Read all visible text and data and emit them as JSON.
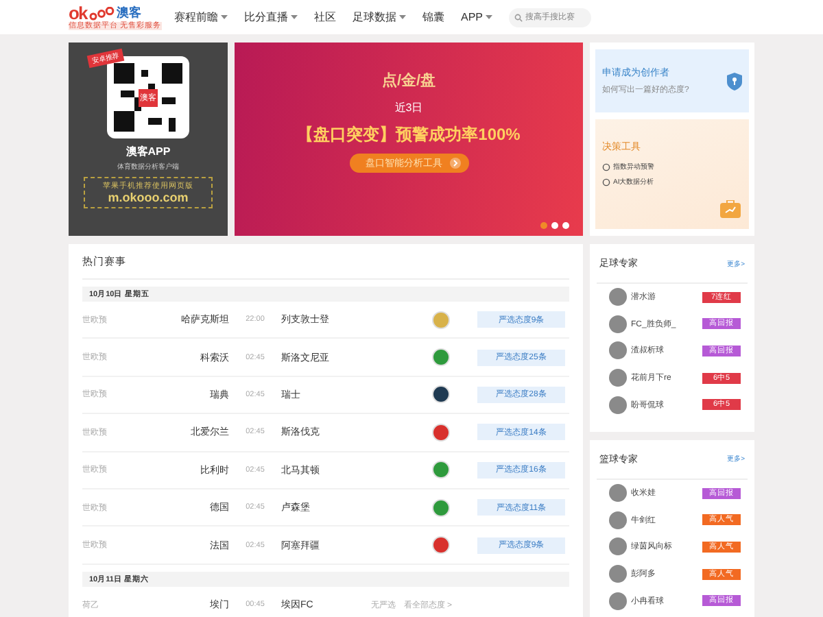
{
  "header": {
    "logo": {
      "mark": "ok",
      "name": "澳客",
      "slogan": "信息数据平台 无售彩服务"
    },
    "nav": [
      {
        "label": "赛程前瞻",
        "has_menu": true
      },
      {
        "label": "比分直播",
        "has_menu": true
      },
      {
        "label": "社区",
        "has_menu": false
      },
      {
        "label": "足球数据",
        "has_menu": true
      },
      {
        "label": "锦囊",
        "has_menu": false
      },
      {
        "label": "APP",
        "has_menu": true
      }
    ],
    "search": {
      "placeholder": "搜高手搜比赛"
    }
  },
  "app_promo": {
    "ribbon": "安卓推荐",
    "qr_badge": "澳客",
    "title": "澳客APP",
    "subtitle": "体育数据分析客户端",
    "note": "苹果手机推荐使用网页版",
    "url": "m.okooo.com"
  },
  "banner": {
    "heading": "点/金/盘",
    "line": "近3日",
    "headline": "【盘口突变】预警成功率100%",
    "button": "盘口智能分析工具",
    "dots": [
      {
        "selected": true
      },
      {
        "selected": false
      },
      {
        "selected": false
      }
    ]
  },
  "creator_card": {
    "title": "申请成为创作者",
    "subtitle": "如何写出一篇好的态度?"
  },
  "tools_card": {
    "title": "决策工具",
    "items": [
      "指数异动预警",
      "AI大数据分析"
    ]
  },
  "hot_matches": {
    "title": "热门赛事",
    "days": [
      {
        "date": "10月10日 星期五",
        "matches": [
          {
            "league": "世欧预",
            "home": "哈萨克斯坦",
            "time": "22:00",
            "away": "列支敦士登",
            "color": "#d8b24a",
            "kind": "pick",
            "action": "严选态度9条"
          },
          {
            "league": "世欧预",
            "home": "科索沃",
            "time": "02:45",
            "away": "斯洛文尼亚",
            "color": "#2e9a3c",
            "kind": "pick",
            "action": "严选态度25条"
          },
          {
            "league": "世欧预",
            "home": "瑞典",
            "time": "02:45",
            "away": "瑞士",
            "color": "#1f3a52",
            "kind": "pick",
            "action": "严选态度28条"
          },
          {
            "league": "世欧预",
            "home": "北爱尔兰",
            "time": "02:45",
            "away": "斯洛伐克",
            "color": "#d8302c",
            "kind": "pick",
            "action": "严选态度14条"
          },
          {
            "league": "世欧预",
            "home": "比利时",
            "time": "02:45",
            "away": "北马其顿",
            "color": "#2e9a3c",
            "kind": "pick",
            "action": "严选态度16条"
          },
          {
            "league": "世欧预",
            "home": "德国",
            "time": "02:45",
            "away": "卢森堡",
            "color": "#2e9a3c",
            "kind": "pick",
            "action": "严选态度11条"
          },
          {
            "league": "世欧预",
            "home": "法国",
            "time": "02:45",
            "away": "阿塞拜疆",
            "color": "#d8302c",
            "kind": "pick",
            "action": "严选态度9条"
          }
        ]
      },
      {
        "date": "10月11日 星期六",
        "matches": [
          {
            "league": "荷乙",
            "home": "埃门",
            "time": "00:45",
            "away": "埃因FC",
            "kind": "none",
            "note": "无严选",
            "action": "看全部态度 >"
          }
        ]
      }
    ]
  },
  "experts": [
    {
      "title": "足球专家",
      "more": "更多>",
      "people": [
        {
          "name": "潜水游",
          "tag": "7连红",
          "color": "#e03a48"
        },
        {
          "name": "FC_胜负师_",
          "tag": "高回报",
          "color": "#b65ad6"
        },
        {
          "name": "渣叔析球",
          "tag": "高回报",
          "color": "#b65ad6"
        },
        {
          "name": "花前月下re",
          "tag": "6中5",
          "color": "#e03a48"
        },
        {
          "name": "盼哥侃球",
          "tag": "6中5",
          "color": "#e03a48"
        }
      ]
    },
    {
      "title": "篮球专家",
      "more": "更多>",
      "people": [
        {
          "name": "收米娃",
          "tag": "高回报",
          "color": "#b65ad6"
        },
        {
          "name": "牛剑红",
          "tag": "高人气",
          "color": "#f26a22"
        },
        {
          "name": "绿茵风向标",
          "tag": "高人气",
          "color": "#f26a22"
        },
        {
          "name": "彭阿多",
          "tag": "高人气",
          "color": "#f26a22"
        },
        {
          "name": "小冉看球",
          "tag": "高回报",
          "color": "#b65ad6"
        }
      ]
    }
  ]
}
